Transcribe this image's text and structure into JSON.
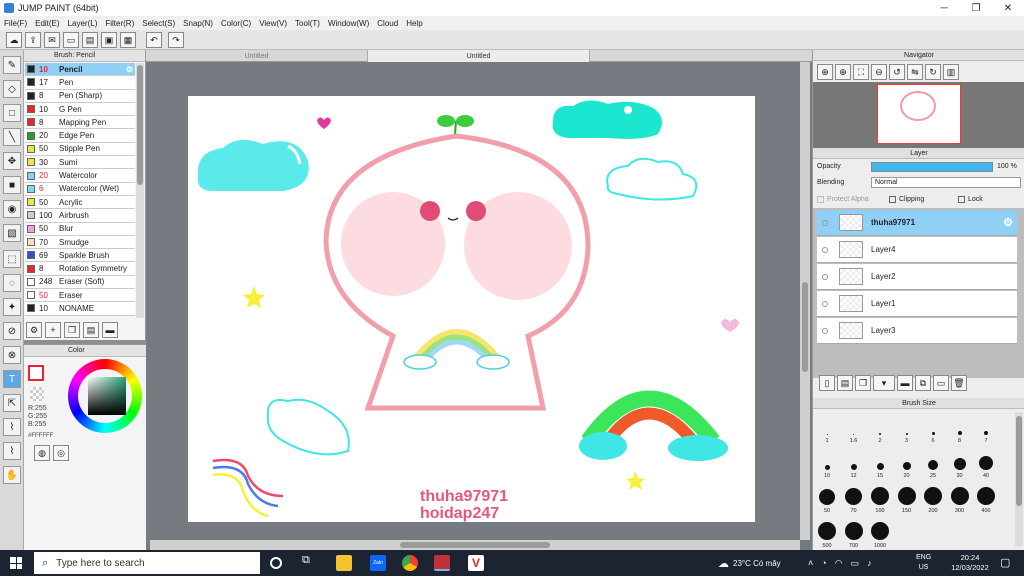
{
  "window": {
    "title": "JUMP PAINT (64bit)",
    "min": "─",
    "max": "❐",
    "close": "✕"
  },
  "menu": [
    "File(F)",
    "Edit(E)",
    "Layer(L)",
    "Filter(R)",
    "Select(S)",
    "Snap(N)",
    "Color(C)",
    "View(V)",
    "Tool(T)",
    "Window(W)",
    "Cloud",
    "Help"
  ],
  "tabs": {
    "t1": "Untitled",
    "t2": "Untitled"
  },
  "brush": {
    "header": "Brush: Pencil",
    "items": [
      {
        "size": "10",
        "name": "Pencil",
        "color": "#222222",
        "sel": true,
        "red": true
      },
      {
        "size": "17",
        "name": "Pen",
        "color": "#222222"
      },
      {
        "size": "8",
        "name": "Pen (Sharp)",
        "color": "#222222"
      },
      {
        "size": "10",
        "name": "G Pen",
        "color": "#e22b2b"
      },
      {
        "size": "8",
        "name": "Mapping Pen",
        "color": "#e22b2b"
      },
      {
        "size": "20",
        "name": "Edge Pen",
        "color": "#22a022"
      },
      {
        "size": "50",
        "name": "Stipple Pen",
        "color": "#e6e64a"
      },
      {
        "size": "30",
        "name": "Sumi",
        "color": "#e6e64a"
      },
      {
        "size": "20",
        "name": "Watercolor",
        "color": "#7fd6f0",
        "red": true
      },
      {
        "size": "6",
        "name": "Watercolor (Wet)",
        "color": "#7fd6f0",
        "red": true
      },
      {
        "size": "50",
        "name": "Acrylic",
        "color": "#e6e64a"
      },
      {
        "size": "100",
        "name": "Airbrush",
        "color": "#cccccc"
      },
      {
        "size": "50",
        "name": "Blur",
        "color": "#f0a0e0"
      },
      {
        "size": "70",
        "name": "Smudge",
        "color": "#f4e0c8"
      },
      {
        "size": "69",
        "name": "Sparkle Brush",
        "color": "#2d4fd6"
      },
      {
        "size": "8",
        "name": "Rotation Symmetry",
        "color": "#e22b2b"
      },
      {
        "size": "248",
        "name": "Eraser (Soft)",
        "color": "#ffffff"
      },
      {
        "size": "50",
        "name": "Eraser",
        "color": "#ffffff",
        "red": true
      },
      {
        "size": "10",
        "name": "NONAME",
        "color": "#222222"
      }
    ]
  },
  "color": {
    "header": "Color",
    "r": "R:255",
    "g": "G:255",
    "b": "B:255",
    "hex": "#FFFFFF"
  },
  "navigator": {
    "header": "Navigator"
  },
  "layer": {
    "header": "Layer",
    "opacity_label": "Opacity",
    "opacity_value": "100 %",
    "blending_label": "Blending",
    "blending_value": "Normal",
    "protect_alpha": "Protect Alpha",
    "clipping": "Clipping",
    "lock": "Lock",
    "items": [
      {
        "name": "thuha97971",
        "sel": true
      },
      {
        "name": "Layer4"
      },
      {
        "name": "Layer2"
      },
      {
        "name": "Layer1"
      },
      {
        "name": "Layer3"
      }
    ]
  },
  "brushsize": {
    "header": "Brush Size",
    "sizes": [
      "1",
      "1.6",
      "2",
      "3",
      "6",
      "8",
      "7",
      "10",
      "12",
      "15",
      "20",
      "25",
      "30",
      "40",
      "50",
      "70",
      "100",
      "150",
      "200",
      "300",
      "400",
      "500",
      "700",
      "1000"
    ]
  },
  "canvas": {
    "watermark1": "thuha97971",
    "watermark2": "hoidap247"
  },
  "taskbar": {
    "search": "Type here to search",
    "weather": "23°C Có mây",
    "lang": "ENG",
    "lang2": "US",
    "time": "20:24",
    "date": "12/03/2022"
  }
}
